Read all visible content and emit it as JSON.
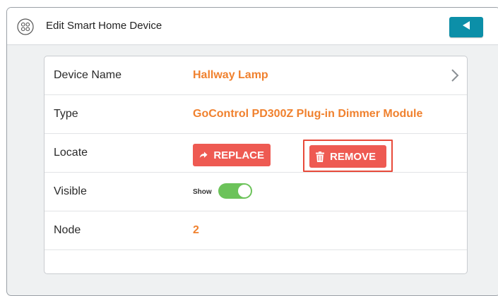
{
  "header": {
    "title": "Edit Smart Home Device",
    "app_icon": "device-grid-icon",
    "back_icon": "back-arrow-icon"
  },
  "device": {
    "rows": [
      {
        "label": "Device Name",
        "value": "Hallway Lamp"
      },
      {
        "label": "Type",
        "value": "GoControl PD300Z Plug-in Dimmer Module"
      },
      {
        "label": "Locate",
        "replace_label": "REPLACE",
        "remove_label": "REMOVE"
      },
      {
        "label": "Visible",
        "toggle_label": "Show",
        "toggle_on": true
      },
      {
        "label": "Node",
        "value": "2"
      }
    ]
  },
  "colors": {
    "accent": "#f0812e",
    "primary": "#0c8fa8",
    "danger": "#ee5a52",
    "toggle_on": "#6cc35a",
    "highlight": "#e84a3a"
  }
}
